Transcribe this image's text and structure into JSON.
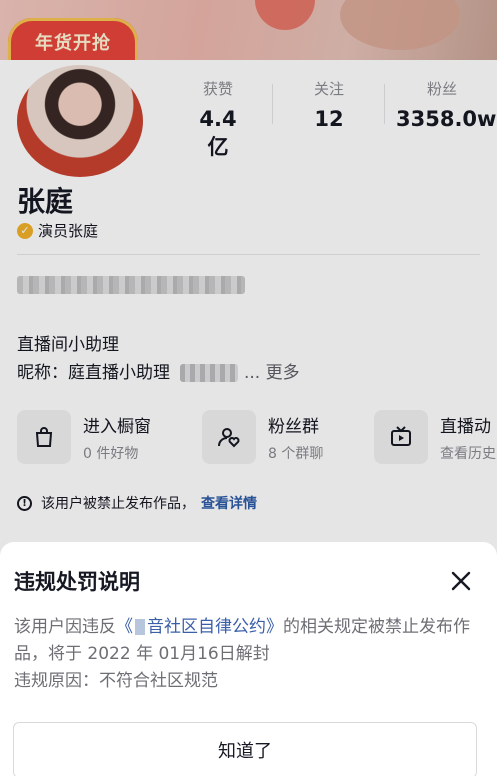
{
  "promo": {
    "badge_text": "年货开抢"
  },
  "profile": {
    "name": "张庭",
    "verified_label": "演员张庭",
    "stats": [
      {
        "label": "获赞",
        "value": "4.4亿"
      },
      {
        "label": "关注",
        "value": "12"
      },
      {
        "label": "粉丝",
        "value": "3358.0w"
      }
    ],
    "bio": {
      "line_assistant": "直播间小助理",
      "nickname_prefix": "昵称：庭直播小助理",
      "more": "... 更多"
    }
  },
  "cards": [
    {
      "title": "进入橱窗",
      "sub": "0 件好物",
      "icon": "bag-icon"
    },
    {
      "title": "粉丝群",
      "sub": "8 个群聊",
      "icon": "group-icon"
    },
    {
      "title": "直播动",
      "sub": "查看历史",
      "icon": "tv-icon"
    }
  ],
  "ban_notice": {
    "text": "该用户被禁止发布作品，",
    "link": "查看详情"
  },
  "sheet": {
    "title": "违规处罚说明",
    "body_part1": "该用户因违反",
    "rule_link_open": "《",
    "rule_link_text": "音社区自律公约》",
    "body_part2": "的相关规定被禁止发布作品，将于 2022 年 01月16日解封",
    "reason": "违规原因：不符合社区规范",
    "ok_button": "知道了"
  },
  "colors": {
    "link": "#2f5ca8",
    "accent_badge": "#e8443a",
    "verify": "#f2b22a"
  }
}
